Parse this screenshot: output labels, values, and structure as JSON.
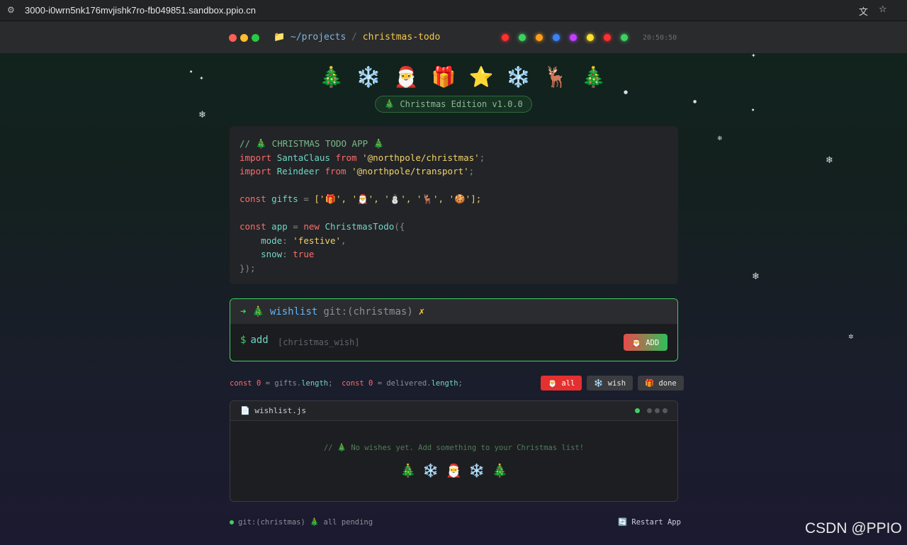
{
  "browser": {
    "url": "3000-i0wrn5nk176mvjishk7ro-fb049851.sandbox.ppio.cn",
    "site_icon": "site-settings-icon",
    "translate_icon": "translate-icon",
    "bookmark_icon": "star-icon"
  },
  "header": {
    "path_prefix": "📁 ~/projects",
    "separator": "/",
    "repo": "christmas-todo",
    "clock": "20:50:50",
    "window_dot_colors": [
      "#ff5f57",
      "#febc2e",
      "#28c840"
    ],
    "light_colors": [
      "#ff3030",
      "#3fd160",
      "#ff9f1a",
      "#3b82f6",
      "#c040ff",
      "#ffe030",
      "#ff3030",
      "#3fd160"
    ]
  },
  "emojis": [
    "🎄",
    "❄️",
    "🎅",
    "🎁",
    "⭐",
    "❄️",
    "🦌",
    "🎄"
  ],
  "badge": "🎄 Christmas Edition v1.0.0",
  "code": {
    "comment": "// 🎄 CHRISTMAS TODO APP 🎄",
    "import1_kw": "import",
    "import1_id": "SantaClaus",
    "import1_from": "from",
    "import1_src": "'@northpole/christmas'",
    "import2_kw": "import",
    "import2_id": "Reindeer",
    "import2_from": "from",
    "import2_src": "'@northpole/transport'",
    "gifts_kw": "const",
    "gifts_id": "gifts",
    "gifts_eq": " = ",
    "gifts_val": "['🎁', '🎅', '⛄', '🦌', '🍪'];",
    "app_kw": "const",
    "app_id": "app",
    "app_eq": " = ",
    "app_new": "new",
    "app_class": "ChristmasTodo",
    "app_open": "({",
    "mode_key": "mode",
    "mode_val": "'festive'",
    "snow_key": "snow",
    "snow_val": "true",
    "close": "});"
  },
  "terminal": {
    "arrow": "➜",
    "tree": "🎄",
    "dir": "wishlist",
    "git": "git:(christmas)",
    "dirty": "✗",
    "prompt": "$",
    "command": "add",
    "placeholder": "[christmas_wish]",
    "value": "",
    "add_button": "🎅 ADD"
  },
  "stats": {
    "const1": "const",
    "count1": "0",
    "obj1": "gifts",
    "prop1": "length",
    "const2": "const",
    "count2": "0",
    "obj2": "delivered",
    "prop2": "length"
  },
  "filters": [
    {
      "label": "🎅 all",
      "active": true
    },
    {
      "label": "❄️ wish",
      "active": false
    },
    {
      "label": "🎁 done",
      "active": false
    }
  ],
  "file": {
    "name": "📄 wishlist.js",
    "empty_message": "// 🎄 No wishes yet. Add something to your Christmas list!",
    "empty_emojis": [
      "🎄",
      "❄️",
      "🎅",
      "❄️",
      "🎄"
    ]
  },
  "footer": {
    "status": "git:(christmas) 🎄 all pending",
    "restart": "🔄 Restart App"
  },
  "watermark": "CSDN @PPIO"
}
